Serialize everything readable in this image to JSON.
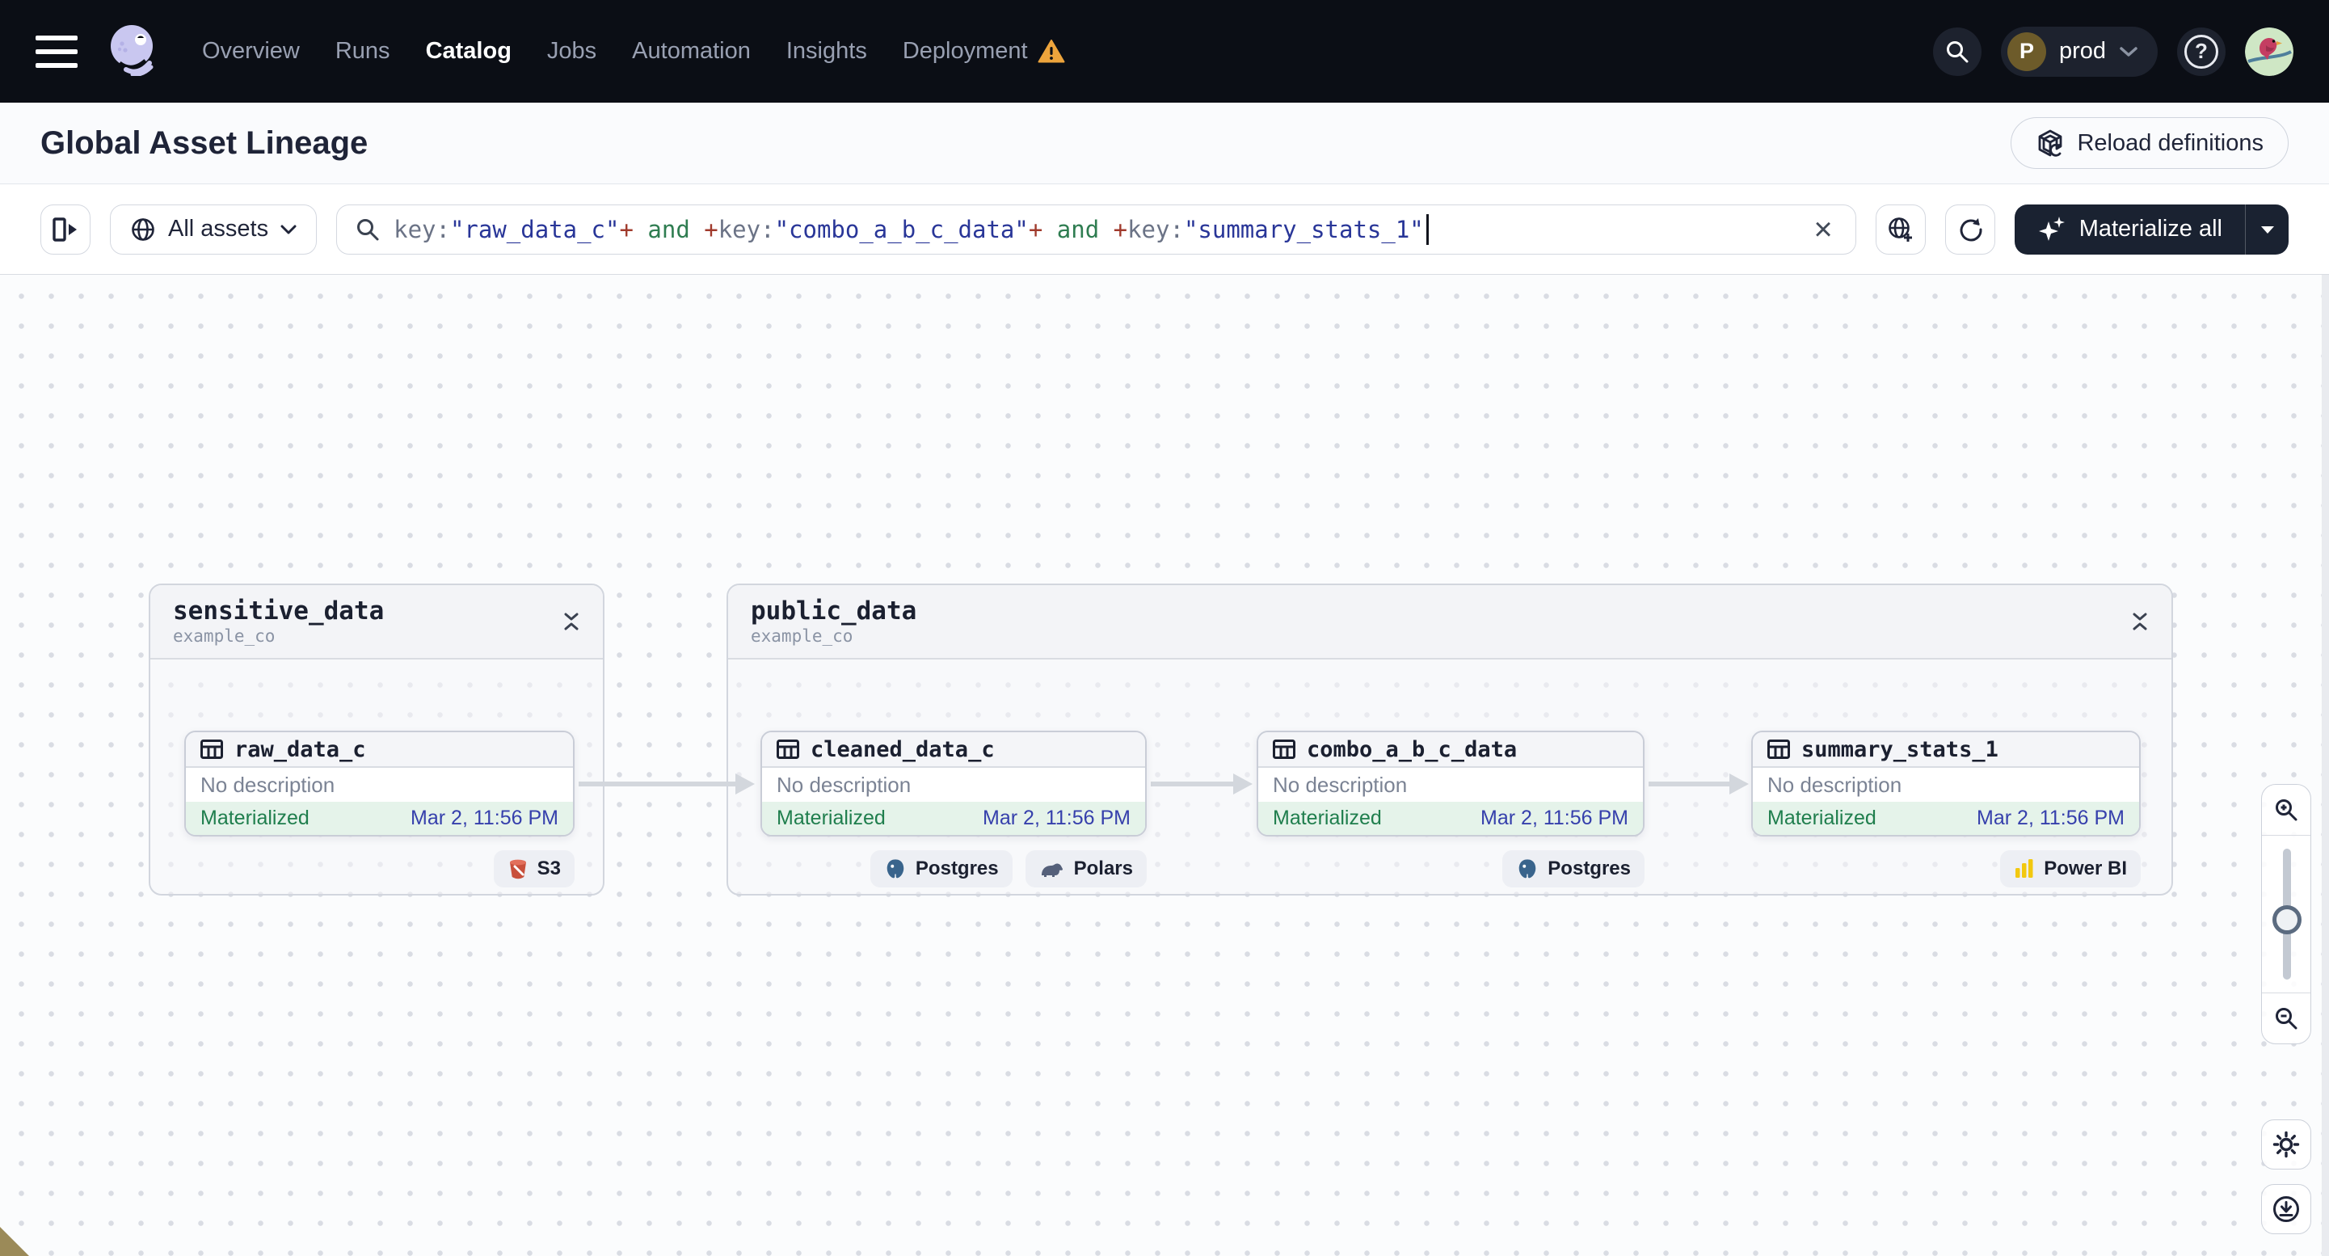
{
  "nav": {
    "items": [
      {
        "label": "Overview",
        "active": false
      },
      {
        "label": "Runs",
        "active": false
      },
      {
        "label": "Catalog",
        "active": true
      },
      {
        "label": "Jobs",
        "active": false
      },
      {
        "label": "Automation",
        "active": false
      },
      {
        "label": "Insights",
        "active": false
      },
      {
        "label": "Deployment",
        "active": false,
        "warning": true
      }
    ],
    "environment": {
      "avatar_letter": "P",
      "label": "prod"
    },
    "help_glyph": "?"
  },
  "header": {
    "title": "Global Asset Lineage",
    "reload_label": "Reload definitions"
  },
  "toolbar": {
    "scope_label": "All assets",
    "materialize_label": "Materialize all",
    "clear_glyph": "×",
    "query_segments": [
      {
        "text": "key:",
        "kind": "key"
      },
      {
        "text": "\"raw_data_c\"",
        "kind": "value"
      },
      {
        "text": "+",
        "kind": "op"
      },
      {
        "text": " and ",
        "kind": "logic"
      },
      {
        "text": "+",
        "kind": "op"
      },
      {
        "text": "key:",
        "kind": "key"
      },
      {
        "text": "\"combo_a_b_c_data\"",
        "kind": "value"
      },
      {
        "text": "+",
        "kind": "op"
      },
      {
        "text": " and ",
        "kind": "logic"
      },
      {
        "text": "+",
        "kind": "op"
      },
      {
        "text": "key:",
        "kind": "key"
      },
      {
        "text": "\"summary_stats_1\"",
        "kind": "value"
      }
    ]
  },
  "graph": {
    "groups": [
      {
        "name": "sensitive_data",
        "location": "example_co"
      },
      {
        "name": "public_data",
        "location": "example_co"
      }
    ],
    "nodes": [
      {
        "title": "raw_data_c",
        "description": "No description",
        "status": "Materialized",
        "timestamp": "Mar 2, 11:56 PM",
        "tags": [
          {
            "label": "S3",
            "icon": "s3-bucket-icon"
          }
        ]
      },
      {
        "title": "cleaned_data_c",
        "description": "No description",
        "status": "Materialized",
        "timestamp": "Mar 2, 11:56 PM",
        "tags": [
          {
            "label": "Postgres",
            "icon": "postgres-icon"
          },
          {
            "label": "Polars",
            "icon": "polars-icon"
          }
        ]
      },
      {
        "title": "combo_a_b_c_data",
        "description": "No description",
        "status": "Materialized",
        "timestamp": "Mar 2, 11:56 PM",
        "tags": [
          {
            "label": "Postgres",
            "icon": "postgres-icon"
          }
        ]
      },
      {
        "title": "summary_stats_1",
        "description": "No description",
        "status": "Materialized",
        "timestamp": "Mar 2, 11:56 PM",
        "tags": [
          {
            "label": "Power BI",
            "icon": "power-bi-icon"
          }
        ]
      }
    ]
  },
  "colors": {
    "nav_background": "#0b0e15",
    "accent_dark": "#1a2231",
    "materialized_green": "#1f7e4d",
    "timestamp_blue": "#3640ac",
    "warning_orange": "#eda43c",
    "query_value_blue": "#293698",
    "query_op_red": "#a03a2c",
    "query_and_green": "#2f7d51"
  }
}
